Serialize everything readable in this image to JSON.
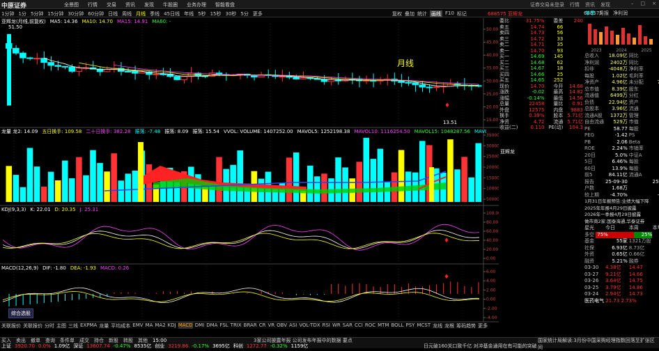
{
  "top_menu": {
    "logo": "中原证券",
    "items": [
      "全景图",
      "行情",
      "交易",
      "资讯",
      "发现",
      "牛股圈",
      "业务办理",
      "智能看盘"
    ],
    "right": [
      "证券交易未登录",
      "行情",
      "资讯",
      "发现"
    ],
    "window": [
      "–",
      "□",
      "×"
    ]
  },
  "period_bar": {
    "items": [
      "1分钟",
      "1分",
      "5分钟",
      "15分钟",
      "30分钟",
      "60分钟",
      "日线",
      "周线",
      "月线",
      "季线",
      "45日线",
      "年线",
      "5秒",
      "15秒",
      "30秒",
      "5分",
      "更多"
    ],
    "active": "月线",
    "tools": [
      "复权",
      "叠加",
      "统计",
      "画线",
      "F10",
      "标记"
    ],
    "stock_title": "688575 亚辉龙",
    "right_code": "688575",
    "right_tabs": [
      "单季",
      "月报",
      "净利润"
    ]
  },
  "main_chart": {
    "header": "亚辉龙(月线,前复权)",
    "ma5": "MA5: 14.36",
    "ma10": "MA10: 14.70",
    "ma15": "MA15: 14.91",
    "ma60": "MA60: -",
    "period_label": "月线",
    "high_price": "51.50",
    "low_price": "13.51",
    "y_labels": [
      "50.00",
      "45.00",
      "40.00",
      "35.00",
      "30.00",
      "25.00",
      "20.00",
      "15.00"
    ]
  },
  "vol_panel": {
    "header": [
      "龙量 龙2: 14.09",
      "五日换手: 109.58",
      "二十日换手: 382.28",
      "振荡: -7.48",
      "振荡: 8.09",
      "振荡: 15.54",
      "VVOL: VOLUME: 1407252.00",
      "MAVOL5: 1252198.38",
      "MAVOL10: 1116254.50",
      "MAVOL15: 1048287.56",
      "MAVOL20: 1015421.67",
      "MAVOL60: -"
    ],
    "y_labels": [
      "350000",
      "300000",
      "250000",
      "200000",
      "150000",
      "100000",
      "50000"
    ]
  },
  "kdj_panel": {
    "header": [
      "KDJ(9,3,3)",
      "K: 22.01",
      "D: 20.35",
      "J: 25.31"
    ],
    "y_labels": [
      "100.00",
      "80.00",
      "60.00",
      "40.00",
      "20.00",
      "0.00"
    ]
  },
  "macd_panel": {
    "header": [
      "MACD(12,26,9)",
      "DIF: -1.80",
      "DEA: -1.93",
      "MACD: 0.26"
    ],
    "y_labels": [
      "6.00",
      "4.00",
      "2.00",
      "0.00",
      "-2.00",
      "-4.00"
    ],
    "badge": "综合选股"
  },
  "indicator_tabs": [
    "关联报价",
    "关联报价",
    "分时",
    "主图",
    "三线",
    "EXPMA",
    "龙量",
    "平均成本",
    "EMV",
    "MA",
    "MA2",
    "KDJ",
    "MACD",
    "DMI",
    "DMA",
    "FSL",
    "TRIX",
    "BRAR",
    "CR",
    "VR",
    "OBV",
    "ASI",
    "VOL-TDX",
    "RSI",
    "WR",
    "SAR",
    "CCI",
    "ROC",
    "MTM",
    "BOLL",
    "PSY",
    "MCST",
    "龙线",
    "龙根",
    "筹码趋势",
    "更多"
  ],
  "indicator_active": "MACD",
  "order_book": {
    "title_code": "688575",
    "title_name": "亚辉龙",
    "wb_label": "委比",
    "wb": "31.75%",
    "wc_label": "委差",
    "wc": "240",
    "sells": [
      [
        "卖五",
        "14.74",
        "66"
      ],
      [
        "卖四",
        "14.73",
        "56"
      ],
      [
        "卖三",
        "14.72",
        "33"
      ],
      [
        "卖二",
        "14.71",
        "35"
      ],
      [
        "卖一",
        "14.70",
        "93"
      ]
    ],
    "buys": [
      [
        "买一",
        "14.69",
        "145"
      ],
      [
        "买二",
        "14.68",
        "62"
      ],
      [
        "买三",
        "14.67",
        "18"
      ],
      [
        "买四",
        "14.66",
        "25"
      ],
      [
        "买五",
        "14.65",
        "252"
      ]
    ],
    "stats": [
      [
        "现价",
        "14.70",
        "今开",
        "14.68"
      ],
      [
        "涨跌",
        "-0.02",
        "最高",
        "14.82"
      ],
      [
        "涨幅",
        "-0.14%",
        "最低",
        "14.56"
      ],
      [
        "总量",
        "22458",
        "量比",
        "0.91"
      ],
      [
        "外盘",
        "12575",
        "内盘",
        "9883"
      ],
      [
        "换手",
        "0.39%",
        "股本",
        "5.71亿"
      ],
      [
        "净资",
        "4.72",
        "流通",
        "5.71亿"
      ],
      [
        "收益(二)",
        "0.110",
        "PE(动)",
        "104.3"
      ]
    ],
    "mini_chart_label": "亚辉龙",
    "mini_prices": [
      "14.83",
      "14.82",
      "14.81",
      "14.80",
      "14.79",
      "14.78",
      "14.77",
      "14.76",
      "14.75",
      "14.74",
      "14.73",
      "14.72",
      "14.71",
      "14.70",
      "14.69",
      "14.68",
      "14.67",
      "14.66",
      "14.65",
      "14.64",
      "14.63",
      "14.62",
      "14.61",
      "14.60",
      "14.59",
      "14.58",
      "14.57",
      "14.56"
    ]
  },
  "financials": {
    "chart_years": [
      "2023",
      "2024",
      "2025"
    ],
    "rows": [
      [
        "总收入",
        "18.09亿",
        "同比",
        "-10.07"
      ],
      [
        "净利润",
        "2402万",
        "同比",
        "-92.03"
      ],
      [
        "扣非",
        "-4048万",
        "净利率",
        "1.33%"
      ],
      [
        "每股",
        "1.02亿",
        "毛利率",
        "5.48亿"
      ],
      [
        "净资产",
        "4.96亿",
        "未分配",
        "7105万"
      ],
      [
        "总市值",
        "8.39亿",
        "股东",
        "1.63亿"
      ],
      [
        "流通值",
        "6499万",
        "分红",
        "6.31亿"
      ],
      [
        "负债",
        "22.94亿",
        "资产",
        "1.73亿"
      ],
      [
        "总股本",
        "3.96亿",
        "流通",
        "1.75亿"
      ],
      [
        "流通A股",
        "1372万",
        "管理",
        "2.94亿"
      ],
      [
        "自由流通",
        "529万",
        "市值",
        "0.89亿"
      ]
    ],
    "valuation": [
      [
        "PE",
        "58.77",
        "每股",
        "3.11"
      ],
      [
        "PEG",
        "-1.42",
        "PS",
        "4.47"
      ],
      [
        "PB",
        "2.06",
        "Beta",
        "0.97"
      ],
      [
        "ROE",
        "2.24%",
        "市销率",
        "37.65"
      ]
    ],
    "rank": [
      [
        "20日",
        "5.0%",
        "中证A",
        "1.75"
      ],
      [
        "5日",
        "6.46%",
        "每股",
        "1.86"
      ],
      [
        "60日",
        "13.9%",
        "每股",
        "1.93"
      ],
      [
        "前5",
        "84.11亿",
        "流通A",
        "2.32"
      ]
    ],
    "dates": [
      [
        "报告",
        "25-09-30",
        "",
        "25-06-30"
      ],
      [
        "户数",
        "1.68万",
        "",
        "1.75"
      ],
      [
        "较上期",
        "-4.70%",
        "",
        "-4.07%"
      ]
    ],
    "news": [
      "1月31日年报预告:业绩大幅下降",
      "2025年年报4月29日披露",
      "2026年一季报4月29日披露",
      "做市商2家:国泰海通,华泰证券"
    ],
    "tabs": [
      "星光",
      "今日",
      "本周",
      "本年"
    ],
    "sentiment_label": "多空",
    "sentiment": [
      "75%",
      "25%"
    ],
    "fund_rows": [
      [
        "基金",
        "55家",
        "1321万股",
        "2"
      ],
      [
        "社保",
        "6.93亿",
        "8.73亿",
        "3"
      ],
      [
        "外资",
        "0.65亿",
        "0.66亿",
        "3"
      ],
      [
        "融资",
        "5.21%",
        "融券",
        "0"
      ]
    ],
    "calendar_header": [
      "日期",
      "",
      ""
    ],
    "calendar": [
      [
        "03-30",
        "4.38亿",
        "14.47"
      ],
      [
        "03-27",
        "9.21亿",
        "14.66"
      ],
      [
        "03-26",
        "3.64亿",
        "14.75"
      ],
      [
        "03-25",
        "3.79亿",
        "14.86"
      ],
      [
        "03-24",
        "2.94亿",
        "14.73"
      ]
    ],
    "bottom_tag": "医药电气",
    "bottom_val": "21.73",
    "bottom_pct": "2.73%"
  },
  "bottom_bar": {
    "items": [
      "上证",
      "3920.70",
      "0.0%",
      "1.09亿",
      "深证",
      "13607.74",
      "-0.47%",
      "8535亿",
      "创业",
      "3219.86",
      "-0.17%",
      "3695亿",
      "科创",
      "1272.77",
      "-0.32%",
      "1159亿"
    ],
    "news1": "日元破160关口致千亿 对冲基金通用在有可能的突破",
    "news2": "国家统计局解读:3月份中国采购经理指数回落至扩张区间"
  },
  "status_bar": {
    "left": [
      "买入",
      "卖出",
      "撤单",
      "查询",
      "条件单",
      "成交",
      "持仓",
      "新股",
      "转股",
      "其他"
    ],
    "scroll": "3家公司披露年报 公司发布年报中的数据 要点",
    "time": "15:00"
  }
}
